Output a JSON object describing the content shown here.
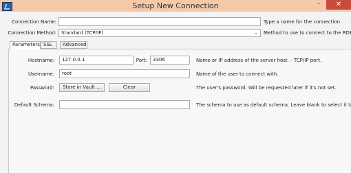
{
  "window": {
    "title": "Setup New Connection",
    "minimize_glyph": "–",
    "close_glyph": "✕",
    "app_icon": "mysql-workbench-icon"
  },
  "connection": {
    "name_label": "Connection Name:",
    "name_value": "",
    "name_hint": "Type a name for the connection",
    "method_label": "Connection Method:",
    "method_value": "Standard (TCP/IP)",
    "method_hint": "Method to use to connect to the RDBMS"
  },
  "tabs": [
    {
      "label": "Parameters",
      "active": true
    },
    {
      "label": "SSL",
      "active": false
    },
    {
      "label": "Advanced",
      "active": false
    }
  ],
  "parameters": {
    "hostname_label": "Hostname:",
    "hostname_value": "127.0.0.1",
    "port_label": "Port:",
    "port_value": "3306",
    "hostname_hint": "Name or IP address of the server host. - TCP/IP port.",
    "username_label": "Username:",
    "username_value": "root",
    "username_hint": "Name of the user to connect with.",
    "password_label": "Password:",
    "store_vault_label": "Store in Vault ...",
    "clear_label": "Clear",
    "password_hint": "The user's password. Will be requested later if it's not set.",
    "schema_label": "Default Schema:",
    "schema_value": "",
    "schema_hint": "The schema to use as default schema. Leave blank to select it later."
  }
}
